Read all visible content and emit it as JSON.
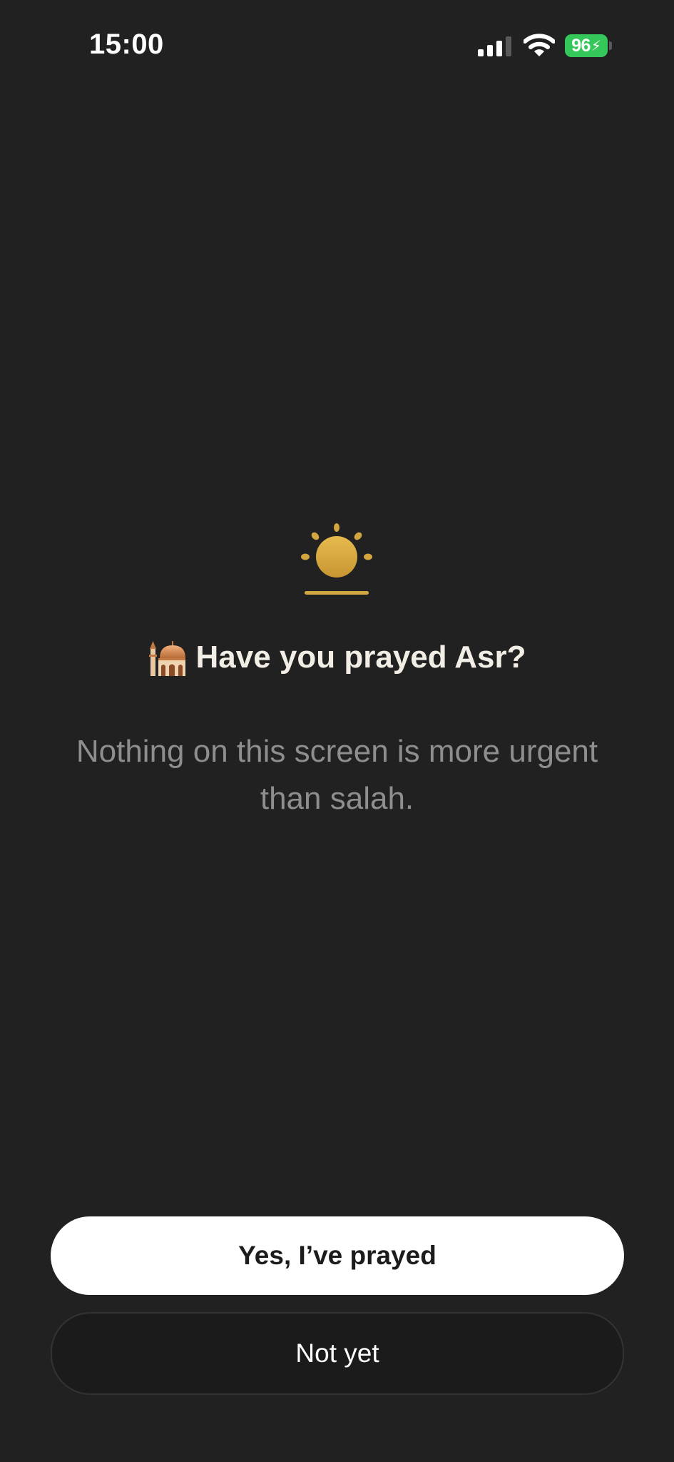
{
  "status_bar": {
    "time": "15:00",
    "battery_level": "96",
    "signal_icon": "cellular-signal-icon",
    "wifi_icon": "wifi-icon",
    "battery_icon": "battery-charging-icon"
  },
  "prompt": {
    "icon": "sun-horizon-icon",
    "title_icon": "mosque-icon",
    "title": "Have you prayed Asr?",
    "subtitle": "Nothing on this screen is more urgent than salah."
  },
  "actions": {
    "confirm_label": "Yes, I’ve prayed",
    "decline_label": "Not yet"
  },
  "colors": {
    "background": "#212121",
    "accent_gold": "#d4a640",
    "battery_green": "#34c759",
    "title_text": "#f2eee6",
    "subtitle_text": "#8e8e8e"
  }
}
